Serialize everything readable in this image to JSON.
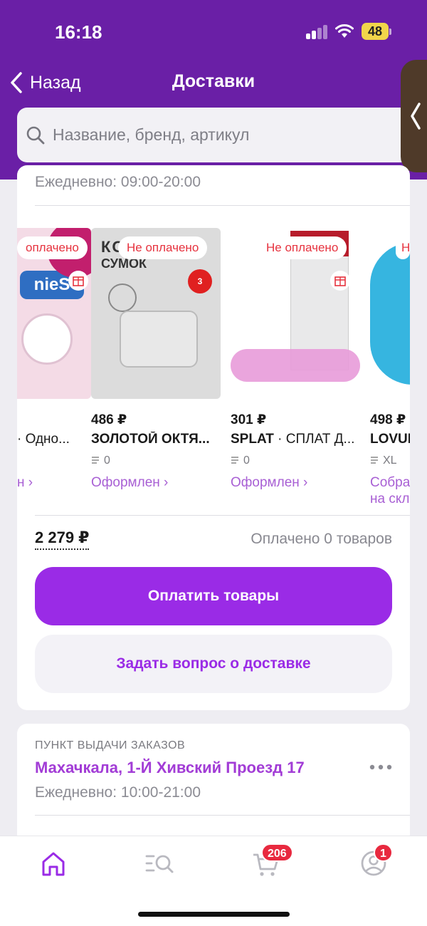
{
  "status_bar": {
    "time": "16:18",
    "battery": "48"
  },
  "header": {
    "back_label": "Назад",
    "title": "Доставки"
  },
  "search": {
    "placeholder": "Название, бренд, артикул",
    "icon": "search-icon"
  },
  "delivery": {
    "cut_hours_text": "Ежедневно: 09:00-20:00",
    "products": [
      {
        "badge": "оплачено",
        "price": "",
        "name": "· Одно...",
        "qty": "",
        "status": "н ›"
      },
      {
        "badge": "Не оплачено",
        "price": "486 ₽",
        "name": "ЗОЛОТОЙ ОКТЯ...",
        "qty": "0",
        "status": "Оформлен ›"
      },
      {
        "badge": "Не оплачено",
        "price": "301 ₽",
        "brand": "SPLAT",
        "name": " · СПЛАТ Д...",
        "qty": "0",
        "status": "Оформлен ›"
      },
      {
        "badge": "Н",
        "price": "498 ₽",
        "name": "LOVUL",
        "qty": "XL",
        "status_line1": "Собра",
        "status_line2": "на скл"
      }
    ],
    "total": "2 279 ₽",
    "paid_count": "Оплачено 0 товаров",
    "pay_button": "Оплатить товары",
    "ask_button": "Задать вопрос о доставке"
  },
  "pickup": {
    "label": "ПУНКТ ВЫДАЧИ ЗАКАЗОВ",
    "address": "Махачкала, 1-Й Хивский Проезд 17",
    "hours": "Ежедневно: 10:00-21:00"
  },
  "tabbar": {
    "cart_count": "206",
    "profile_count": "1"
  },
  "colors": {
    "header": "#6a1fa6",
    "accent": "#9a2be6",
    "link": "#a85fd4",
    "badge_red": "#e8293f"
  }
}
